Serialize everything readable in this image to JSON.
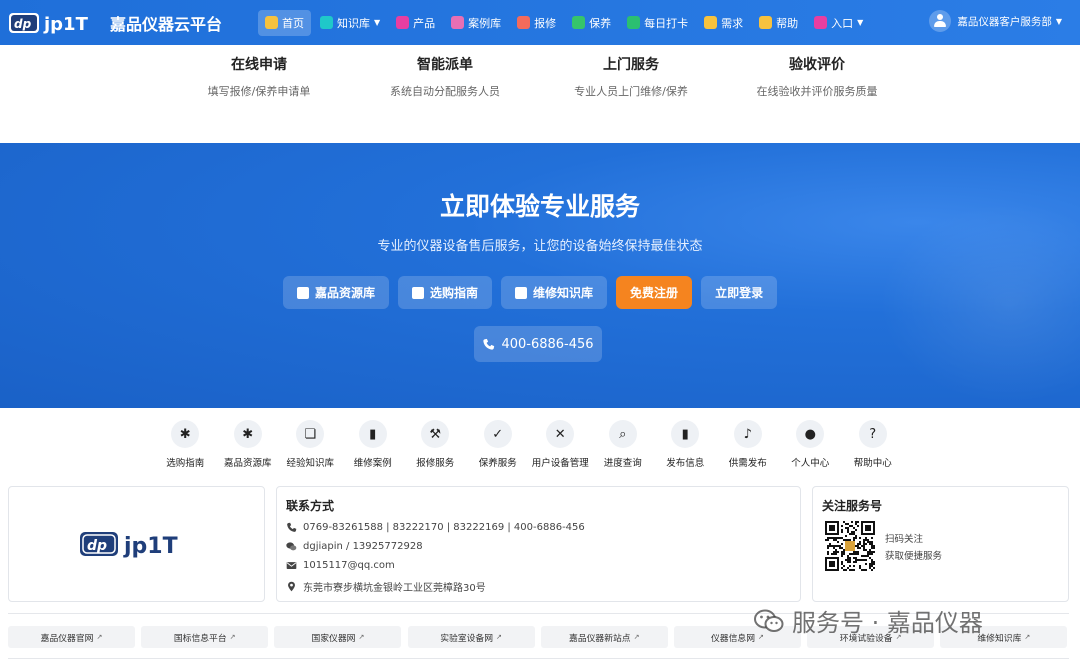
{
  "header": {
    "logo_text": "jp1T",
    "title": "嘉品仪器云平台",
    "nav": [
      {
        "label": "首页",
        "icon": "home-icon",
        "color": "#f7c23e",
        "active": true
      },
      {
        "label": "知识库",
        "icon": "book-icon",
        "color": "#1fc8c9",
        "dropdown": true
      },
      {
        "label": "产品",
        "icon": "gear-icon",
        "color": "#e83ea1"
      },
      {
        "label": "案例库",
        "icon": "clipboard-check-icon",
        "color": "#e86fb4"
      },
      {
        "label": "报修",
        "icon": "clipboard-icon",
        "color": "#f36b5c"
      },
      {
        "label": "保养",
        "icon": "check-icon",
        "color": "#36c56a"
      },
      {
        "label": "每日打卡",
        "icon": "calendar-icon",
        "color": "#2bbf71"
      },
      {
        "label": "需求",
        "icon": "bell-icon",
        "color": "#f7c23e"
      },
      {
        "label": "帮助",
        "icon": "question-icon",
        "color": "#f7c23e"
      },
      {
        "label": "入口",
        "icon": "gear-icon",
        "color": "#e83ea1",
        "dropdown": true
      }
    ],
    "user": {
      "name": "嘉品仪器客户服务部"
    }
  },
  "steps": [
    {
      "title": "在线申请",
      "desc": "填写报修/保养申请单"
    },
    {
      "title": "智能派单",
      "desc": "系统自动分配服务人员"
    },
    {
      "title": "上门服务",
      "desc": "专业人员上门维修/保养"
    },
    {
      "title": "验收评价",
      "desc": "在线验收并评价服务质量"
    }
  ],
  "hero": {
    "title": "立即体验专业服务",
    "subtitle": "专业的仪器设备售后服务，让您的设备始终保持最佳状态",
    "buttons": [
      {
        "label": "嘉品资源库",
        "icon": "book-icon"
      },
      {
        "label": "选购指南",
        "icon": "cart-icon"
      },
      {
        "label": "维修知识库",
        "icon": "open-book-icon"
      },
      {
        "label": "免费注册",
        "icon": "",
        "accent": "#f5841f"
      },
      {
        "label": "立即登录",
        "icon": ""
      }
    ],
    "phone": "400-6886-456"
  },
  "quick_links": [
    {
      "label": "选购指南",
      "icon": "gear-icon"
    },
    {
      "label": "嘉品资源库",
      "icon": "gear-icon"
    },
    {
      "label": "经验知识库",
      "icon": "open-book-icon"
    },
    {
      "label": "维修案例",
      "icon": "book-icon"
    },
    {
      "label": "报修服务",
      "icon": "wrench-icon"
    },
    {
      "label": "保养服务",
      "icon": "clipboard-check-icon"
    },
    {
      "label": "用户设备管理",
      "icon": "tools-icon"
    },
    {
      "label": "进度查询",
      "icon": "search-icon"
    },
    {
      "label": "发布信息",
      "icon": "book-icon"
    },
    {
      "label": "供需发布",
      "icon": "bell-icon"
    },
    {
      "label": "个人中心",
      "icon": "user-icon"
    },
    {
      "label": "帮助中心",
      "icon": "question-icon"
    }
  ],
  "footer": {
    "logo_text": "jp1T",
    "contact": {
      "title": "联系方式",
      "phone": "0769-83261588 | 83222170 | 83222169 | 400-6886-456",
      "wechat": "dgjiapin / 13925772928",
      "email": "1015117@qq.com",
      "address": "东莞市寮步横坑金银岭工业区莞樟路30号"
    },
    "follow": {
      "title": "关注服务号",
      "line1": "扫码关注",
      "line2": "获取便捷服务"
    }
  },
  "links": [
    "嘉品仪器官网",
    "国标信息平台",
    "国家仪器网",
    "实验室设备网",
    "嘉品仪器新站点",
    "仪器信息网",
    "环境试验设备",
    "维修知识库"
  ],
  "watermark": {
    "text": "服务号 · 嘉品仪器"
  },
  "colors": {
    "primary": "#1f6fd9",
    "accent": "#f5841f"
  }
}
